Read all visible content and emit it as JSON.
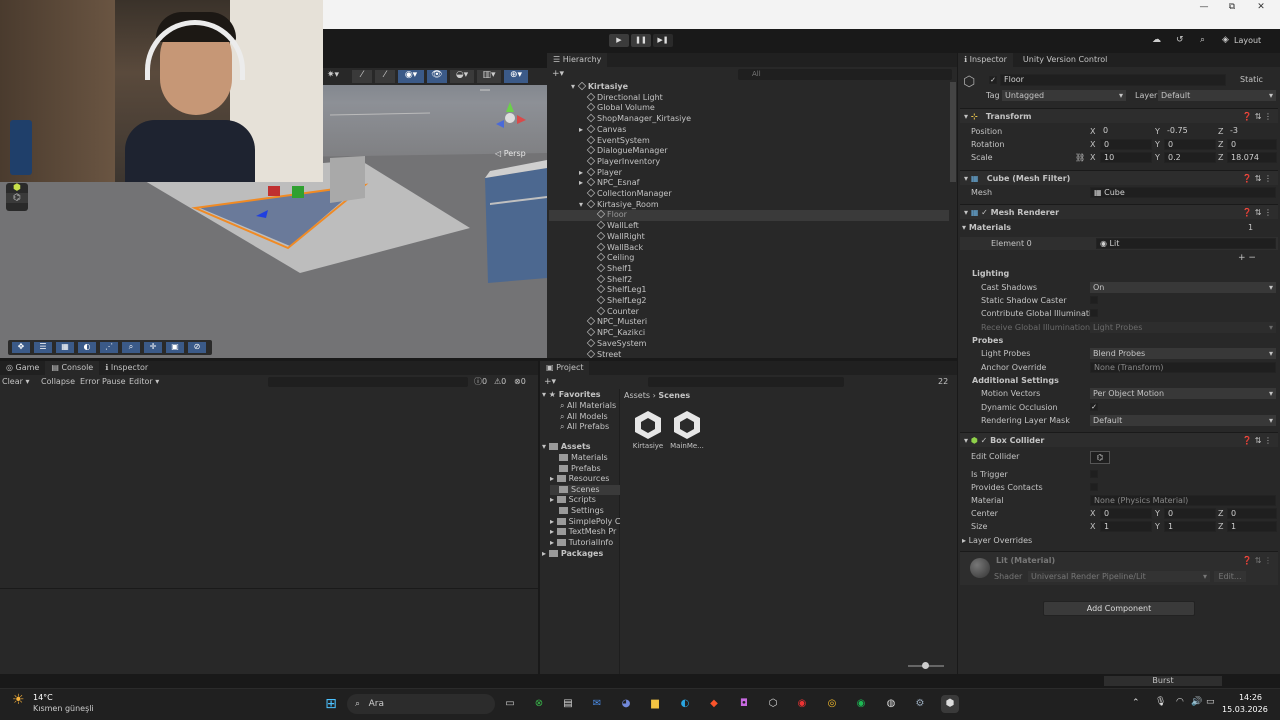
{
  "window": {
    "minimize": "—",
    "maximize": "⧉",
    "close": "✕"
  },
  "toolbar": {
    "layout": "Layout"
  },
  "scene": {
    "persp": "◁ Persp"
  },
  "hierarchy": {
    "tab": "Hierarchy",
    "search_placeholder": "All",
    "root": "Kirtasiye",
    "items": [
      {
        "label": "Directional Light",
        "depth": 1
      },
      {
        "label": "Global Volume",
        "depth": 1
      },
      {
        "label": "ShopManager_Kirtasiye",
        "depth": 1
      },
      {
        "label": "Canvas",
        "depth": 1,
        "fold": true
      },
      {
        "label": "EventSystem",
        "depth": 1
      },
      {
        "label": "DialogueManager",
        "depth": 1
      },
      {
        "label": "PlayerInventory",
        "depth": 1
      },
      {
        "label": "Player",
        "depth": 1,
        "fold": true
      },
      {
        "label": "NPC_Esnaf",
        "depth": 1,
        "fold": true
      },
      {
        "label": "CollectionManager",
        "depth": 1
      },
      {
        "label": "Kirtasiye_Room",
        "depth": 1,
        "open": true
      },
      {
        "label": "Floor",
        "depth": 2,
        "selected": true
      },
      {
        "label": "WallLeft",
        "depth": 2
      },
      {
        "label": "WallRight",
        "depth": 2
      },
      {
        "label": "WallBack",
        "depth": 2
      },
      {
        "label": "Ceiling",
        "depth": 2
      },
      {
        "label": "Shelf1",
        "depth": 2
      },
      {
        "label": "Shelf2",
        "depth": 2
      },
      {
        "label": "ShelfLeg1",
        "depth": 2
      },
      {
        "label": "ShelfLeg2",
        "depth": 2
      },
      {
        "label": "Counter",
        "depth": 2
      },
      {
        "label": "NPC_Musteri",
        "depth": 1
      },
      {
        "label": "NPC_Kazikci",
        "depth": 1
      },
      {
        "label": "SaveSystem",
        "depth": 1
      },
      {
        "label": "Street",
        "depth": 1
      }
    ]
  },
  "console": {
    "tabs": [
      "Game",
      "Console",
      "Inspector"
    ],
    "clear": "Clear",
    "collapse": "Collapse",
    "error_pause": "Error Pause",
    "editor": "Editor",
    "counts": [
      "0",
      "0",
      "0"
    ]
  },
  "project": {
    "tab": "Project",
    "count": "22",
    "favorites": "Favorites",
    "fav_items": [
      "All Materials",
      "All Models",
      "All Prefabs"
    ],
    "assets": "Assets",
    "asset_items": [
      "Materials",
      "Prefabs",
      "Resources",
      "Scenes",
      "Scripts",
      "Settings",
      "SimplePoly C",
      "TextMesh Pr",
      "TutorialInfo"
    ],
    "packages": "Packages",
    "breadcrumb": [
      "Assets",
      "Scenes"
    ],
    "files": [
      "Kirtasiye",
      "MainMe..."
    ]
  },
  "inspector": {
    "tabs": [
      "Inspector",
      "Unity Version Control"
    ],
    "object_name": "Floor",
    "static": "Static",
    "tag_label": "Tag",
    "tag": "Untagged",
    "layer_label": "Layer",
    "layer": "Default",
    "transform": {
      "title": "Transform",
      "position": {
        "label": "Position",
        "x": "0",
        "y": "-0.75",
        "z": "-3"
      },
      "rotation": {
        "label": "Rotation",
        "x": "0",
        "y": "0",
        "z": "0"
      },
      "scale": {
        "label": "Scale",
        "x": "10",
        "y": "0.2",
        "z": "18.074"
      }
    },
    "meshfilter": {
      "title": "Cube (Mesh Filter)",
      "mesh_label": "Mesh",
      "mesh": "Cube"
    },
    "meshrenderer": {
      "title": "Mesh Renderer",
      "materials": "Materials",
      "materials_count": "1",
      "element0": "Element 0",
      "element0_value": "Lit",
      "lighting": "Lighting",
      "cast_shadows": "Cast Shadows",
      "cast_shadows_value": "On",
      "static_shadow": "Static Shadow Caster",
      "contribute_gi": "Contribute Global Illuminatio",
      "receive_gi": "Receive Global Illumination",
      "receive_gi_value": "Light Probes",
      "probes": "Probes",
      "light_probes": "Light Probes",
      "light_probes_value": "Blend Probes",
      "anchor": "Anchor Override",
      "anchor_value": "None (Transform)",
      "additional": "Additional Settings",
      "motion": "Motion Vectors",
      "motion_value": "Per Object Motion",
      "dyn_occ": "Dynamic Occlusion",
      "rlm": "Rendering Layer Mask",
      "rlm_value": "Default"
    },
    "boxcollider": {
      "title": "Box Collider",
      "edit": "Edit Collider",
      "trigger": "Is Trigger",
      "contacts": "Provides Contacts",
      "material": "Material",
      "material_value": "None (Physics Material)",
      "center": {
        "label": "Center",
        "x": "0",
        "y": "0",
        "z": "0"
      },
      "size": {
        "label": "Size",
        "x": "1",
        "y": "1",
        "z": "1"
      },
      "overrides": "Layer Overrides"
    },
    "material": {
      "name": "Lit (Material)",
      "shader_label": "Shader",
      "shader": "Universal Render Pipeline/Lit",
      "edit": "Edit..."
    },
    "add_component": "Add Component"
  },
  "status": {
    "burst": "Burst"
  },
  "taskbar": {
    "temp": "14°C",
    "weather": "Kısmen güneşli",
    "search": "Ara",
    "time": "14:26",
    "date": "15.03.2026"
  },
  "colors": {
    "accent": "#2c5d87",
    "selection": "#3a3a3a",
    "orange_outline": "#f08a24"
  }
}
